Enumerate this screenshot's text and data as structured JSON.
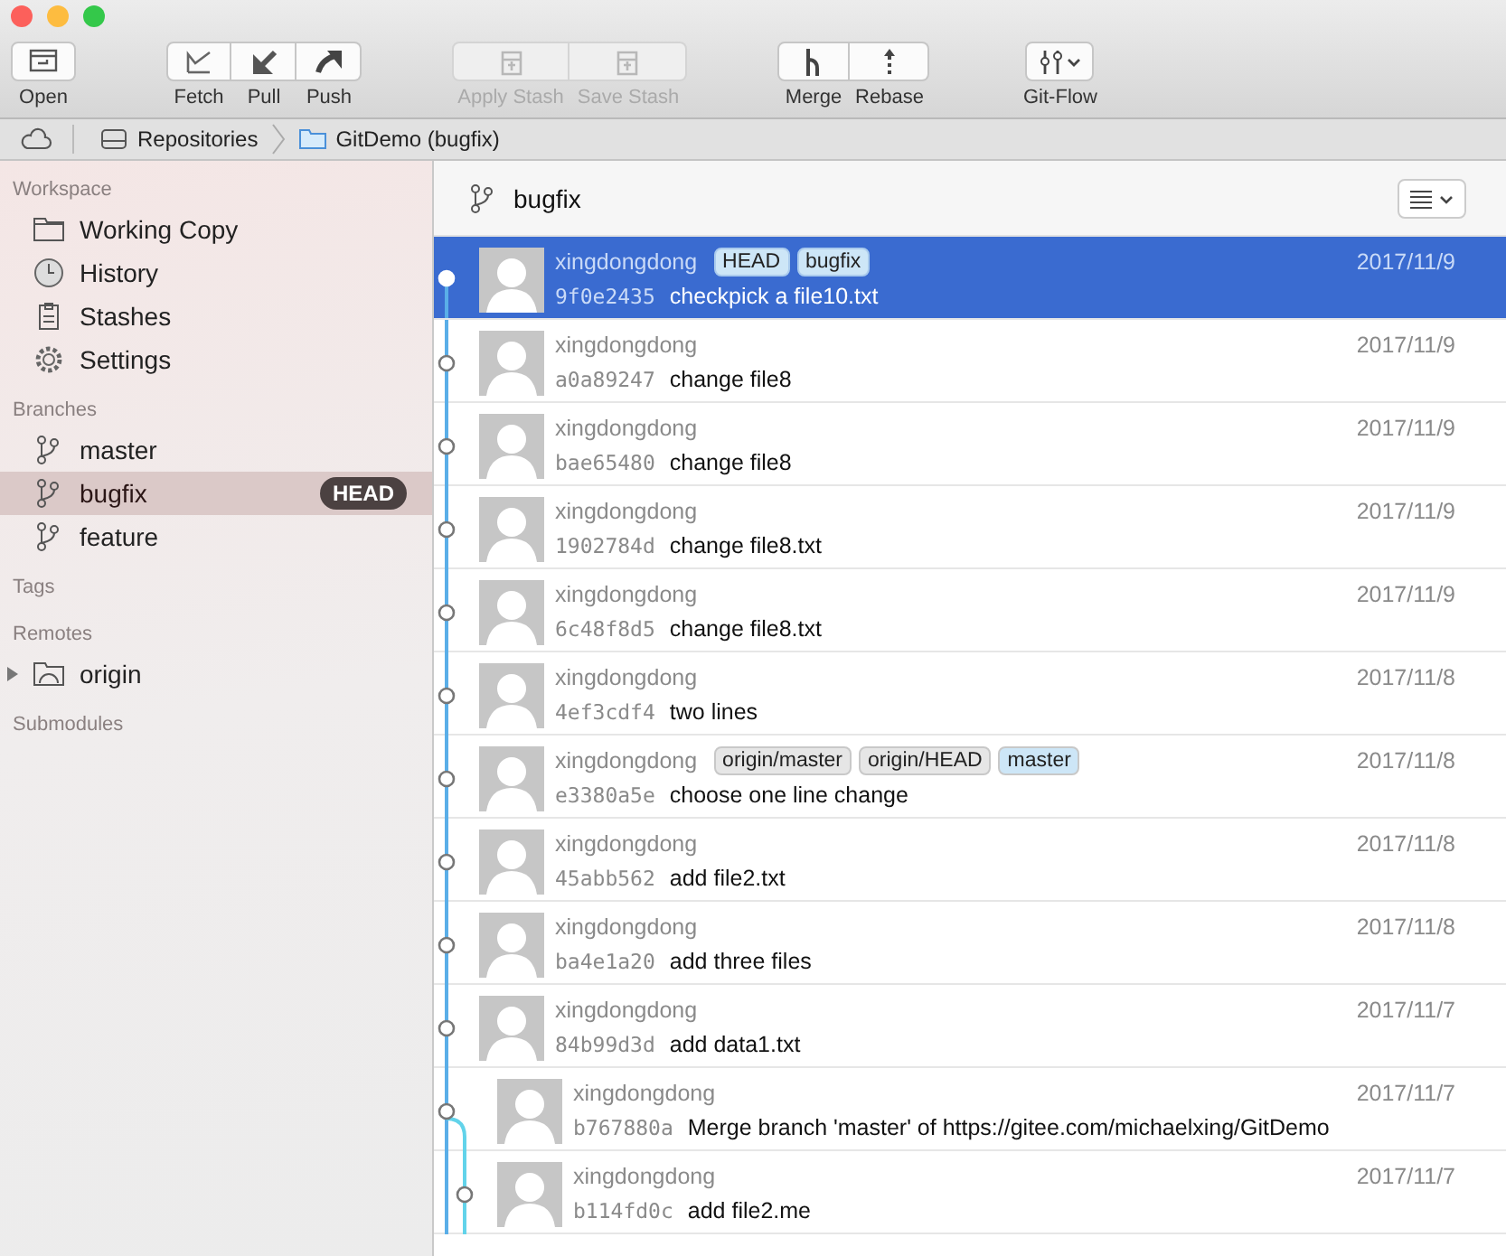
{
  "toolbar": {
    "groups": [
      {
        "items": [
          {
            "kind": "open",
            "label": "Open",
            "disabled": false
          }
        ]
      },
      {
        "items": [
          {
            "kind": "fetch",
            "label": "Fetch",
            "disabled": false
          },
          {
            "kind": "pull",
            "label": "Pull",
            "disabled": false
          },
          {
            "kind": "push",
            "label": "Push",
            "disabled": false
          }
        ]
      },
      {
        "items": [
          {
            "kind": "stash",
            "label": "Apply Stash",
            "disabled": true
          },
          {
            "kind": "stash",
            "label": "Save Stash",
            "disabled": true
          }
        ]
      },
      {
        "items": [
          {
            "kind": "merge",
            "label": "Merge",
            "disabled": false
          },
          {
            "kind": "rebase",
            "label": "Rebase",
            "disabled": false
          }
        ]
      },
      {
        "items": [
          {
            "kind": "gitflow",
            "label": "Git-Flow",
            "disabled": false
          }
        ]
      }
    ]
  },
  "path_bar": {
    "items": [
      {
        "kind": "drive",
        "label": "Repositories"
      },
      {
        "kind": "folder",
        "label": "GitDemo (bugfix)"
      }
    ]
  },
  "sidebar": {
    "sections": [
      {
        "title": "Workspace",
        "items": [
          {
            "kind": "folder",
            "label": "Working Copy",
            "selected": false
          },
          {
            "kind": "clock",
            "label": "History",
            "selected": false
          },
          {
            "kind": "clipboard",
            "label": "Stashes",
            "selected": false
          },
          {
            "kind": "gear",
            "label": "Settings",
            "selected": false
          }
        ]
      },
      {
        "title": "Branches",
        "items": [
          {
            "kind": "branch",
            "label": "master",
            "selected": false
          },
          {
            "kind": "branch",
            "label": "bugfix",
            "selected": true,
            "badge": "HEAD"
          },
          {
            "kind": "branch",
            "label": "feature",
            "selected": false
          }
        ]
      },
      {
        "title": "Tags"
      },
      {
        "title": "Remotes",
        "items": [
          {
            "kind": "remote",
            "label": "origin",
            "selected": false,
            "expanded": false
          }
        ]
      },
      {
        "title": "Submodules"
      }
    ]
  },
  "history": {
    "branch": "bugfix",
    "commits": [
      {
        "author": "xingdongdong",
        "tags": [
          {
            "label": "HEAD",
            "color": "#cde6f7"
          },
          {
            "label": "bugfix",
            "color": "#cde6f7"
          }
        ],
        "hash": "9f0e2435",
        "message": "checkpick a file10.txt",
        "date": "2017/11/9",
        "selected": true,
        "kind": "tip"
      },
      {
        "author": "xingdongdong",
        "hash": "a0a89247",
        "message": "change file8",
        "date": "2017/11/9",
        "selected": false,
        "kind": "main"
      },
      {
        "author": "xingdongdong",
        "hash": "bae65480",
        "message": "change file8",
        "date": "2017/11/9",
        "selected": false,
        "kind": "main"
      },
      {
        "author": "xingdongdong",
        "hash": "1902784d",
        "message": "change file8.txt",
        "date": "2017/11/9",
        "selected": false,
        "kind": "main"
      },
      {
        "author": "xingdongdong",
        "hash": "6c48f8d5",
        "message": "change file8.txt",
        "date": "2017/11/9",
        "selected": false,
        "kind": "main"
      },
      {
        "author": "xingdongdong",
        "hash": "4ef3cdf4",
        "message": "two lines",
        "date": "2017/11/8",
        "selected": false,
        "kind": "main"
      },
      {
        "author": "xingdongdong",
        "tags": [
          {
            "label": "origin/master",
            "color": "#e6e6e6"
          },
          {
            "label": "origin/HEAD",
            "color": "#e6e6e6"
          },
          {
            "label": "master",
            "color": "#cde6f7"
          }
        ],
        "hash": "e3380a5e",
        "message": "choose one line change",
        "date": "2017/11/8",
        "selected": false,
        "kind": "main"
      },
      {
        "author": "xingdongdong",
        "hash": "45abb562",
        "message": "add file2.txt",
        "date": "2017/11/8",
        "selected": false,
        "kind": "main"
      },
      {
        "author": "xingdongdong",
        "hash": "ba4e1a20",
        "message": "add three files",
        "date": "2017/11/8",
        "selected": false,
        "kind": "main"
      },
      {
        "author": "xingdongdong",
        "hash": "84b99d3d",
        "message": "add data1.txt",
        "date": "2017/11/7",
        "selected": false,
        "kind": "main"
      },
      {
        "author": "xingdongdong",
        "hash": "b767880a",
        "message": "Merge branch 'master' of https://gitee.com/michaelxing/GitDemo",
        "date": "2017/11/7",
        "selected": false,
        "kind": "merge"
      },
      {
        "author": "xingdongdong",
        "hash": "b114fd0c",
        "message": "add file2.me",
        "date": "2017/11/7",
        "selected": false,
        "kind": "side"
      }
    ]
  }
}
